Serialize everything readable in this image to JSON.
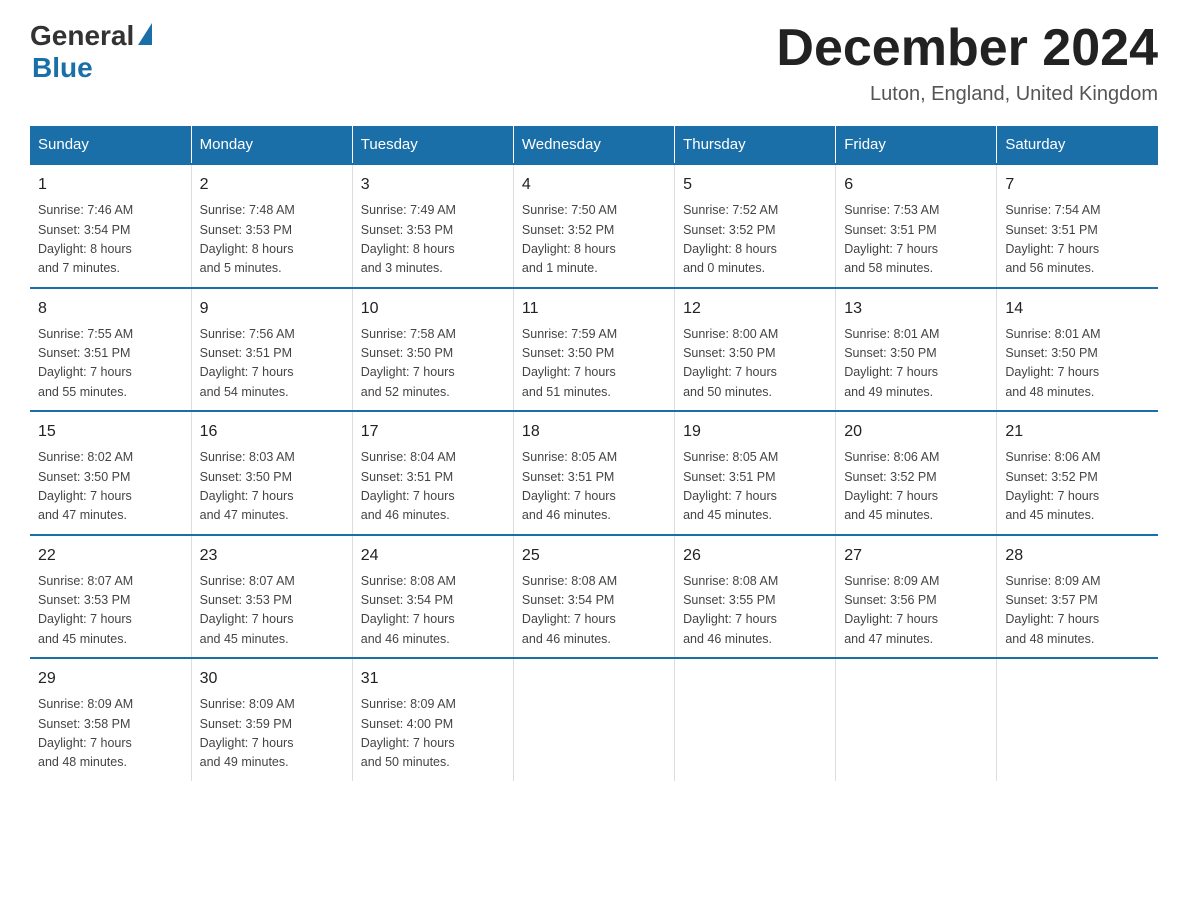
{
  "header": {
    "logo_general": "General",
    "logo_blue": "Blue",
    "month_title": "December 2024",
    "location": "Luton, England, United Kingdom"
  },
  "days_of_week": [
    "Sunday",
    "Monday",
    "Tuesday",
    "Wednesday",
    "Thursday",
    "Friday",
    "Saturday"
  ],
  "weeks": [
    [
      {
        "day": "1",
        "info": "Sunrise: 7:46 AM\nSunset: 3:54 PM\nDaylight: 8 hours\nand 7 minutes."
      },
      {
        "day": "2",
        "info": "Sunrise: 7:48 AM\nSunset: 3:53 PM\nDaylight: 8 hours\nand 5 minutes."
      },
      {
        "day": "3",
        "info": "Sunrise: 7:49 AM\nSunset: 3:53 PM\nDaylight: 8 hours\nand 3 minutes."
      },
      {
        "day": "4",
        "info": "Sunrise: 7:50 AM\nSunset: 3:52 PM\nDaylight: 8 hours\nand 1 minute."
      },
      {
        "day": "5",
        "info": "Sunrise: 7:52 AM\nSunset: 3:52 PM\nDaylight: 8 hours\nand 0 minutes."
      },
      {
        "day": "6",
        "info": "Sunrise: 7:53 AM\nSunset: 3:51 PM\nDaylight: 7 hours\nand 58 minutes."
      },
      {
        "day": "7",
        "info": "Sunrise: 7:54 AM\nSunset: 3:51 PM\nDaylight: 7 hours\nand 56 minutes."
      }
    ],
    [
      {
        "day": "8",
        "info": "Sunrise: 7:55 AM\nSunset: 3:51 PM\nDaylight: 7 hours\nand 55 minutes."
      },
      {
        "day": "9",
        "info": "Sunrise: 7:56 AM\nSunset: 3:51 PM\nDaylight: 7 hours\nand 54 minutes."
      },
      {
        "day": "10",
        "info": "Sunrise: 7:58 AM\nSunset: 3:50 PM\nDaylight: 7 hours\nand 52 minutes."
      },
      {
        "day": "11",
        "info": "Sunrise: 7:59 AM\nSunset: 3:50 PM\nDaylight: 7 hours\nand 51 minutes."
      },
      {
        "day": "12",
        "info": "Sunrise: 8:00 AM\nSunset: 3:50 PM\nDaylight: 7 hours\nand 50 minutes."
      },
      {
        "day": "13",
        "info": "Sunrise: 8:01 AM\nSunset: 3:50 PM\nDaylight: 7 hours\nand 49 minutes."
      },
      {
        "day": "14",
        "info": "Sunrise: 8:01 AM\nSunset: 3:50 PM\nDaylight: 7 hours\nand 48 minutes."
      }
    ],
    [
      {
        "day": "15",
        "info": "Sunrise: 8:02 AM\nSunset: 3:50 PM\nDaylight: 7 hours\nand 47 minutes."
      },
      {
        "day": "16",
        "info": "Sunrise: 8:03 AM\nSunset: 3:50 PM\nDaylight: 7 hours\nand 47 minutes."
      },
      {
        "day": "17",
        "info": "Sunrise: 8:04 AM\nSunset: 3:51 PM\nDaylight: 7 hours\nand 46 minutes."
      },
      {
        "day": "18",
        "info": "Sunrise: 8:05 AM\nSunset: 3:51 PM\nDaylight: 7 hours\nand 46 minutes."
      },
      {
        "day": "19",
        "info": "Sunrise: 8:05 AM\nSunset: 3:51 PM\nDaylight: 7 hours\nand 45 minutes."
      },
      {
        "day": "20",
        "info": "Sunrise: 8:06 AM\nSunset: 3:52 PM\nDaylight: 7 hours\nand 45 minutes."
      },
      {
        "day": "21",
        "info": "Sunrise: 8:06 AM\nSunset: 3:52 PM\nDaylight: 7 hours\nand 45 minutes."
      }
    ],
    [
      {
        "day": "22",
        "info": "Sunrise: 8:07 AM\nSunset: 3:53 PM\nDaylight: 7 hours\nand 45 minutes."
      },
      {
        "day": "23",
        "info": "Sunrise: 8:07 AM\nSunset: 3:53 PM\nDaylight: 7 hours\nand 45 minutes."
      },
      {
        "day": "24",
        "info": "Sunrise: 8:08 AM\nSunset: 3:54 PM\nDaylight: 7 hours\nand 46 minutes."
      },
      {
        "day": "25",
        "info": "Sunrise: 8:08 AM\nSunset: 3:54 PM\nDaylight: 7 hours\nand 46 minutes."
      },
      {
        "day": "26",
        "info": "Sunrise: 8:08 AM\nSunset: 3:55 PM\nDaylight: 7 hours\nand 46 minutes."
      },
      {
        "day": "27",
        "info": "Sunrise: 8:09 AM\nSunset: 3:56 PM\nDaylight: 7 hours\nand 47 minutes."
      },
      {
        "day": "28",
        "info": "Sunrise: 8:09 AM\nSunset: 3:57 PM\nDaylight: 7 hours\nand 48 minutes."
      }
    ],
    [
      {
        "day": "29",
        "info": "Sunrise: 8:09 AM\nSunset: 3:58 PM\nDaylight: 7 hours\nand 48 minutes."
      },
      {
        "day": "30",
        "info": "Sunrise: 8:09 AM\nSunset: 3:59 PM\nDaylight: 7 hours\nand 49 minutes."
      },
      {
        "day": "31",
        "info": "Sunrise: 8:09 AM\nSunset: 4:00 PM\nDaylight: 7 hours\nand 50 minutes."
      },
      {
        "day": "",
        "info": ""
      },
      {
        "day": "",
        "info": ""
      },
      {
        "day": "",
        "info": ""
      },
      {
        "day": "",
        "info": ""
      }
    ]
  ]
}
